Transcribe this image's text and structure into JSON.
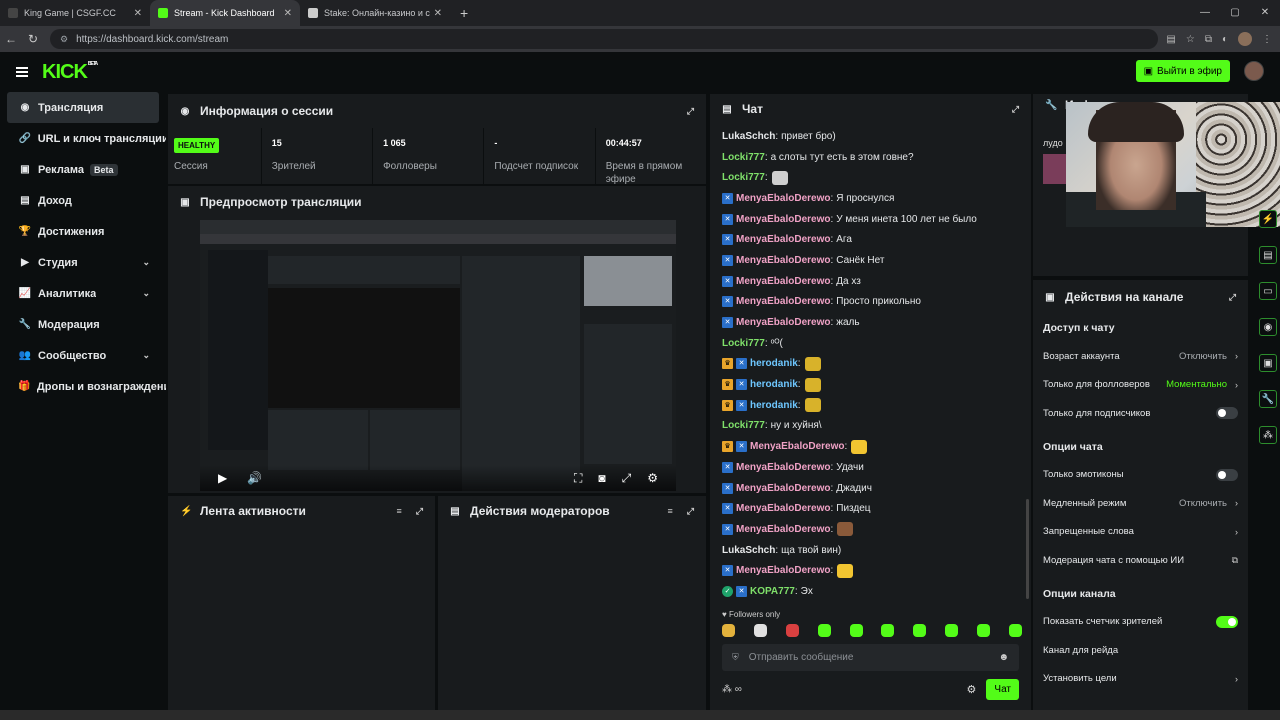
{
  "browser": {
    "tabs": [
      {
        "title": "King Game | CSGF.CC",
        "active": false,
        "favicon_color": "#444"
      },
      {
        "title": "Stream - Kick Dashboard",
        "active": true,
        "favicon_color": "#53fc18"
      },
      {
        "title": "Stake: Онлайн-казино и ставки н",
        "active": false,
        "favicon_color": "#ccc"
      }
    ],
    "url": "https://dashboard.kick.com/stream"
  },
  "header": {
    "logo": "KICK",
    "logo_badge": "BETA",
    "golive_label": "Выйти в эфир"
  },
  "sidebar": {
    "items": [
      {
        "label": "Трансляция",
        "icon": "◉",
        "icon_name": "stream-icon",
        "active": true
      },
      {
        "label": "URL и ключ трансляции",
        "icon": "🔗",
        "icon_name": "link-icon"
      },
      {
        "label": "Реклама",
        "icon": "▣",
        "icon_name": "ads-icon",
        "badge": "Beta"
      },
      {
        "label": "Доход",
        "icon": "▤",
        "icon_name": "income-icon"
      },
      {
        "label": "Достижения",
        "icon": "🏆",
        "icon_name": "trophy-icon"
      },
      {
        "label": "Студия",
        "icon": "▶",
        "icon_name": "studio-icon",
        "chevron": true
      },
      {
        "label": "Аналитика",
        "icon": "📈",
        "icon_name": "analytics-icon",
        "chevron": true
      },
      {
        "label": "Модерация",
        "icon": "🔧",
        "icon_name": "wrench-icon"
      },
      {
        "label": "Сообщество",
        "icon": "👥",
        "icon_name": "community-icon",
        "chevron": true
      },
      {
        "label": "Дропы и вознаграждения",
        "icon": "🎁",
        "icon_name": "gift-icon"
      }
    ]
  },
  "session": {
    "title": "Информация о сессии",
    "health": "HEALTHY",
    "health_label": "Сессия",
    "stats": [
      {
        "value": "15",
        "label": "Зрителей"
      },
      {
        "value": "1 065",
        "label": "Фолловеры"
      },
      {
        "value": "-",
        "label": "Подсчет подписок"
      },
      {
        "value": "00:44:57",
        "label": "Время в прямом эфире"
      }
    ]
  },
  "preview": {
    "title": "Предпросмотр трансляции"
  },
  "activity": {
    "title": "Лента активности"
  },
  "modactions": {
    "title": "Действия модераторов"
  },
  "chat": {
    "title": "Чат",
    "messages": [
      {
        "user": "LukaSchch",
        "color": "#e6e8ea",
        "text": "привет бро)"
      },
      {
        "user": "Locki777",
        "color": "#7fe06a",
        "text": "а слоты тут есть в этом говне?"
      },
      {
        "user": "Locki777",
        "color": "#7fe06a",
        "text": "",
        "emote": "#cfcfcf"
      },
      {
        "user": "MenyaEbaloDerewo",
        "color": "#f0a2c6",
        "text": "Я проснулся",
        "badges": [
          "k"
        ]
      },
      {
        "user": "MenyaEbaloDerewo",
        "color": "#f0a2c6",
        "text": "У меня инета 100 лет не было",
        "badges": [
          "k"
        ]
      },
      {
        "user": "MenyaEbaloDerewo",
        "color": "#f0a2c6",
        "text": "Ага",
        "badges": [
          "k"
        ]
      },
      {
        "user": "MenyaEbaloDerewo",
        "color": "#f0a2c6",
        "text": "Санёк Нет",
        "badges": [
          "k"
        ]
      },
      {
        "user": "MenyaEbaloDerewo",
        "color": "#f0a2c6",
        "text": "Да хз",
        "badges": [
          "k"
        ]
      },
      {
        "user": "MenyaEbaloDerewo",
        "color": "#f0a2c6",
        "text": "Просто прикольно",
        "badges": [
          "k"
        ]
      },
      {
        "user": "MenyaEbaloDerewo",
        "color": "#f0a2c6",
        "text": "жаль",
        "badges": [
          "k"
        ]
      },
      {
        "user": "Locki777",
        "color": "#7fe06a",
        "text": "ᵒᴼ(",
        "badges": []
      },
      {
        "user": "herodanik",
        "color": "#6ec7ff",
        "text": "",
        "badges": [
          "c",
          "k"
        ],
        "emote": "#d8b22a"
      },
      {
        "user": "herodanik",
        "color": "#6ec7ff",
        "text": "",
        "badges": [
          "c",
          "k"
        ],
        "emote": "#d8b22a"
      },
      {
        "user": "herodanik",
        "color": "#6ec7ff",
        "text": "",
        "badges": [
          "c",
          "k"
        ],
        "emote": "#d8b22a"
      },
      {
        "user": "Locki777",
        "color": "#7fe06a",
        "text": "ну и хуйня\\",
        "badges": []
      },
      {
        "user": "MenyaEbaloDerewo",
        "color": "#f0a2c6",
        "text": "",
        "badges": [
          "c",
          "k"
        ],
        "emote": "#f2c531"
      },
      {
        "user": "MenyaEbaloDerewo",
        "color": "#f0a2c6",
        "text": "Удачи",
        "badges": [
          "k"
        ]
      },
      {
        "user": "MenyaEbaloDerewo",
        "color": "#f0a2c6",
        "text": "Джадич",
        "badges": [
          "k"
        ]
      },
      {
        "user": "MenyaEbaloDerewo",
        "color": "#f0a2c6",
        "text": "Пиздец",
        "badges": [
          "k"
        ]
      },
      {
        "user": "MenyaEbaloDerewo",
        "color": "#f0a2c6",
        "text": "",
        "badges": [
          "k"
        ],
        "emote": "#8a5a3a"
      },
      {
        "user": "LukaSchch",
        "color": "#e6e8ea",
        "text": "ща твой вин)",
        "badges": []
      },
      {
        "user": "MenyaEbaloDerewo",
        "color": "#f0a2c6",
        "text": "",
        "badges": [
          "k"
        ],
        "emote": "#f2c531"
      },
      {
        "user": "KOPA777",
        "color": "#7fe06a",
        "text": "Эх",
        "badges": [
          "s",
          "k"
        ]
      }
    ],
    "followers_only": "Followers only",
    "emote_colors": [
      "#e3b23c",
      "#e0e0e0",
      "#d94040",
      "#53fc18",
      "#53fc18",
      "#53fc18",
      "#53fc18",
      "#53fc18",
      "#53fc18",
      "#53fc18"
    ],
    "placeholder": "Отправить сообщение",
    "send_label": "Чат"
  },
  "channel_info": {
    "title": "Информация о",
    "overflow_label": "лудо"
  },
  "channel_actions": {
    "title": "Действия на канале",
    "chat_access": "Доступ к чату",
    "account_age": {
      "label": "Возраст аккаунта",
      "value": "Отключить"
    },
    "followers_only": {
      "label": "Только для фолловеров",
      "value": "Моментально"
    },
    "subs_only": {
      "label": "Только для подписчиков",
      "on": false
    },
    "chat_options": "Опции чата",
    "emotes_only": {
      "label": "Только эмотиконы",
      "on": false
    },
    "slow_mode": {
      "label": "Медленный режим",
      "value": "Отключить"
    },
    "banned_words": {
      "label": "Запрещенные слова"
    },
    "ai_mod": {
      "label": "Модерация чата с помощью ИИ"
    },
    "channel_options": "Опции канала",
    "viewer_count": {
      "label": "Показать счетчик зрителей",
      "on": true
    },
    "raid_channel": {
      "label": "Канал для рейда"
    },
    "goals": {
      "label": "Установить цели"
    }
  }
}
